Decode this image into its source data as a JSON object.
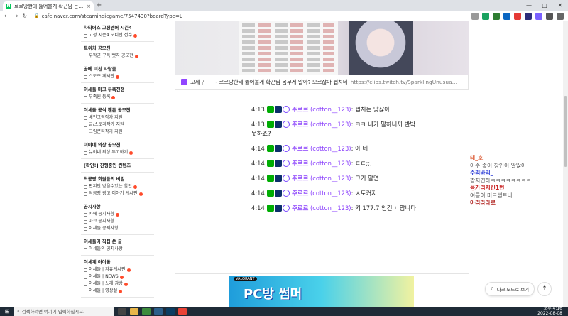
{
  "browser": {
    "tab_title": "르르망한테 뚫어볼게 확끈님 돈…",
    "tab_close": "×",
    "new_tab": "+",
    "url": "cafe.naver.com/steamindiegame/7547430?boardType=L",
    "window_controls": [
      "—",
      "□",
      "✕"
    ]
  },
  "sidebar": {
    "sections": [
      {
        "head": "차타버스 고정멤버 시즌4",
        "items": [
          {
            "label": "고정 시즌4 모티션 접수",
            "new": true
          }
        ]
      },
      {
        "head": "트위치 공모전",
        "items": [
          {
            "label": "우왁굳 구독 뱃지 공모전",
            "new": true
          }
        ]
      },
      {
        "head": "공에 미친 사람들",
        "items": [
          {
            "label": "스토즈 게시판",
            "new": true
          }
        ]
      },
      {
        "head": "이세돌 마크 부족전쟁",
        "items": [
          {
            "label": "부족원 등록",
            "new": true
          }
        ]
      },
      {
        "head": "이세돌 공식 팬튼 공모전",
        "items": [
          {
            "label": "베인그림작가 지원",
            "new": false
          },
          {
            "label": "글/스토리작가 지원",
            "new": false
          },
          {
            "label": "그림콘티작가 지원",
            "new": false
          }
        ]
      },
      {
        "head": "이야네 의상 공모전",
        "items": [
          {
            "label": "뉴이네 의상 투고하기",
            "new": true
          }
        ]
      },
      {
        "head": "[확인!] 진행중인 컨텐츠",
        "items": []
      },
      {
        "head": "탁꽁빵 회원들의 비밀",
        "items": [
          {
            "label": "편지만 받을수있는 할인",
            "new": true
          },
          {
            "label": "탁꽁빵 광고 이야기 게시판",
            "new": true
          }
        ]
      },
      {
        "head": "공지사항",
        "items": [
          {
            "label": "카페 공지사항",
            "new": true
          },
          {
            "label": "마크 공지사항",
            "new": false
          },
          {
            "label": "이세돌 공지사항",
            "new": false
          }
        ]
      },
      {
        "head": "이세돌이 직접 쓴 글",
        "items": [
          {
            "label": "이세돌의 공지사항",
            "new": false
          }
        ]
      },
      {
        "head": "이세계 아이돌",
        "items": [
          {
            "label": "이세돌 | 자유게시판",
            "new": true
          },
          {
            "label": "이세돌 | NEWS",
            "new": true
          },
          {
            "label": "이세돌 | 노래 감상",
            "new": true
          },
          {
            "label": "이세돌 | 영상실",
            "new": true
          }
        ]
      }
    ]
  },
  "post": {
    "link_user": "고세구___",
    "link_text": "- 르르망한테 뚫어볼게 확끈님 몸무게 알아? 모르잖아 찝치네",
    "link_url": "https://clips.twitch.tv/SparklingUnusua…"
  },
  "chat": [
    {
      "time": "4:13",
      "user": "주르르",
      "uid": "(cotton__123)",
      "text": "찝치는 맞잖아"
    },
    {
      "time": "4:13",
      "user": "주르르",
      "uid": "(cotton__123)",
      "text": "ㅋㅋ 내가 말하니까 반박 못하죠?"
    },
    {
      "time": "4:14",
      "user": "주르르",
      "uid": "(cotton__123)",
      "text": "아 네"
    },
    {
      "time": "4:14",
      "user": "주르르",
      "uid": "(cotton__123)",
      "text": "ㄷㄷ;;;"
    },
    {
      "time": "4:14",
      "user": "주르르",
      "uid": "(cotton__123)",
      "text": "그거 알면"
    },
    {
      "time": "4:14",
      "user": "주르르",
      "uid": "(cotton__123)",
      "text": "ㅅ토커지"
    },
    {
      "time": "4:14",
      "user": "주르르",
      "uid": "(cotton__123)",
      "text": "키 177.7 인건 ㄴ압니다"
    }
  ],
  "ad": {
    "tag": "VALORANT",
    "headline": "PC방 썸머"
  },
  "overlay_chat": [
    {
      "name": "태_호",
      "color": "#e06c4a",
      "text": ""
    },
    {
      "name": "",
      "color": "#555555",
      "text": "아주 좋이 장인이 알많아"
    },
    {
      "name": "주리바리_",
      "color": "#2a3bd6",
      "text": ""
    },
    {
      "name": "",
      "color": "#555555",
      "text": "짬치긴하ㅋㅋㅋㅋㅋㅋㅋㅋ"
    },
    {
      "name": "용가리치킨1번",
      "color": "#c71f1f",
      "text": ""
    },
    {
      "name": "",
      "color": "#555555",
      "text": "여름이 미드썸트나"
    },
    {
      "name": "아리라라로",
      "color": "#b0221f",
      "text": ""
    }
  ],
  "buttons": {
    "dark_mode": "다크 모드로 보기",
    "to_top": "↑"
  },
  "taskbar": {
    "search_placeholder": "검색하려면 여기에 입력하십시오.",
    "time": "오후 4:16",
    "date": "2022-08-08"
  }
}
